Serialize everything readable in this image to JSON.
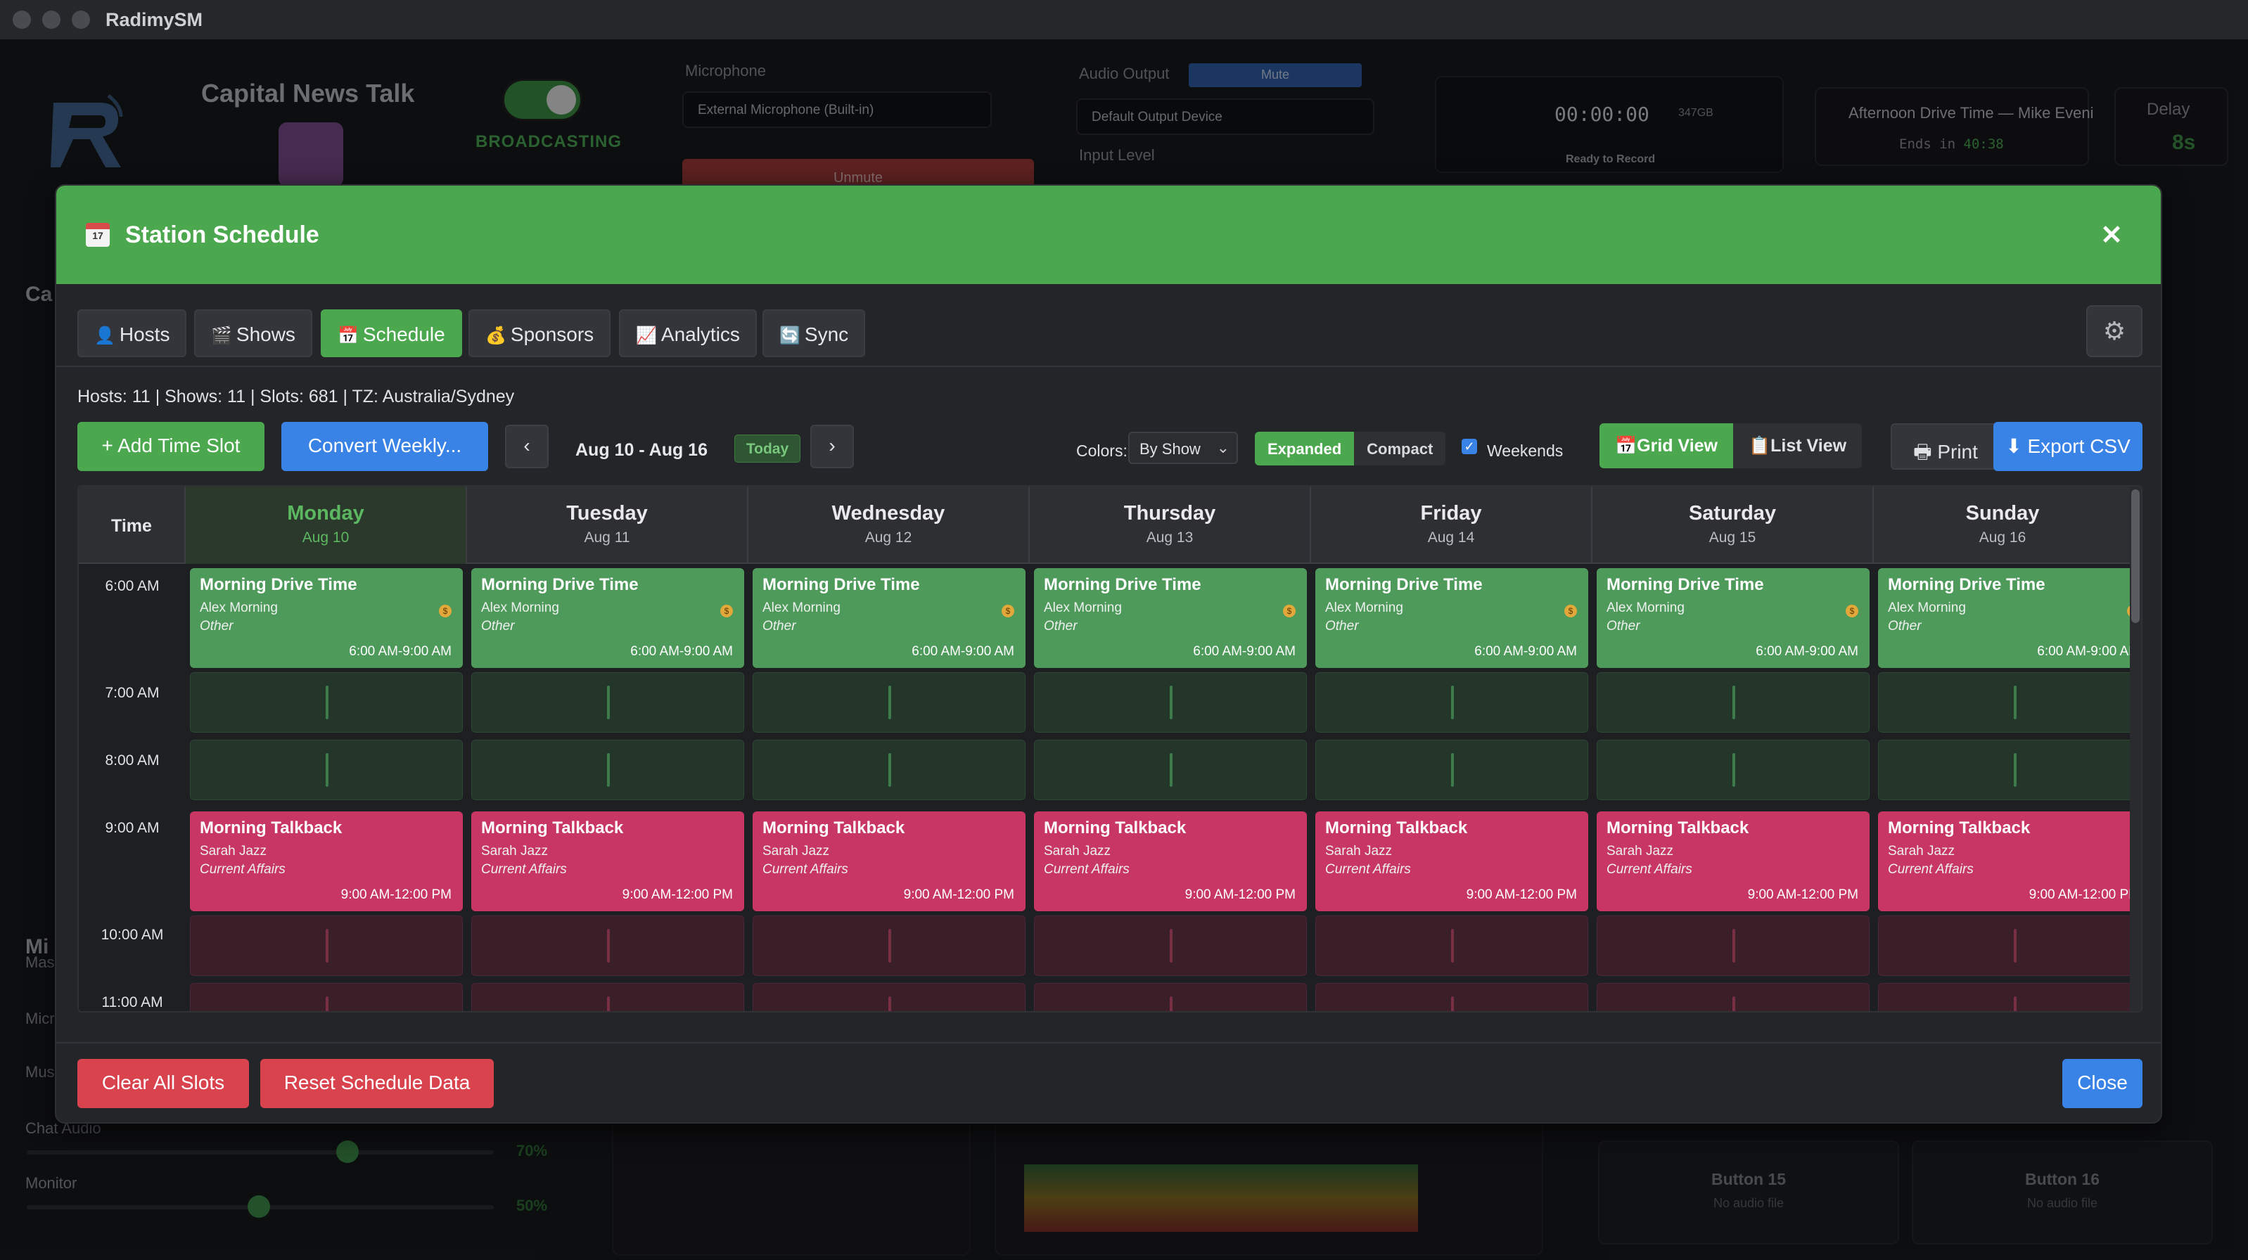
{
  "window": {
    "title": "RadimySM"
  },
  "background": {
    "station_name": "Capital News Talk",
    "broadcasting_label": "BROADCASTING",
    "microphone_label": "Microphone",
    "microphone_device": "External Microphone (Built-in)",
    "unmute_label": "Unmute",
    "audio_output_label": "Audio Output",
    "mute_label": "Mute",
    "output_device": "Default Output Device",
    "input_level_label": "Input Level",
    "timer": "00:00:00",
    "disk_free": "347GB",
    "ready_label": "Ready to Record",
    "now_playing": "Afternoon Drive Time — Mike Eveni",
    "ends_in_prefix": "Ends in",
    "ends_in_value": "40:38",
    "delay_label": "Delay",
    "delay_value": "8s",
    "left_heading": "Ca",
    "mixer_heading": "Mi",
    "faders": [
      {
        "label": "Mas",
        "percent": null
      },
      {
        "label": "Micr",
        "percent": null
      },
      {
        "label": "Mus",
        "percent": null
      },
      {
        "label": "Chat Audio",
        "percent": "70%",
        "level": 0.7
      },
      {
        "label": "Monitor",
        "percent": "50%",
        "level": 0.5
      }
    ],
    "buttons": [
      {
        "title": "Button 15",
        "subtitle": "No audio file"
      },
      {
        "title": "Button 16",
        "subtitle": "No audio file"
      }
    ]
  },
  "modal": {
    "title": "Station Schedule",
    "close_glyph": "✕",
    "tabs": [
      {
        "icon": "👤",
        "label": "Hosts"
      },
      {
        "icon": "🎬",
        "label": "Shows"
      },
      {
        "icon": "📅",
        "label": "Schedule",
        "active": true
      },
      {
        "icon": "💰",
        "label": "Sponsors"
      },
      {
        "icon": "📈",
        "label": "Analytics"
      },
      {
        "icon": "🔄",
        "label": "Sync"
      }
    ],
    "stats": "Hosts: 11 | Shows: 11 | Slots: 681 | TZ: Australia/Sydney",
    "toolbar": {
      "add_slot": "+ Add Time Slot",
      "convert_weekly": "Convert Weekly...",
      "prev": "‹",
      "next": "›",
      "week_range": "Aug 10 - Aug 16",
      "today": "Today",
      "colors_label": "Colors:",
      "colors_value": "By Show",
      "expanded": "Expanded",
      "compact": "Compact",
      "weekends": "Weekends",
      "grid_view": "Grid View",
      "list_view": "List View",
      "print": "Print",
      "export_csv": "Export CSV"
    },
    "grid": {
      "time_header": "Time",
      "days": [
        {
          "name": "Monday",
          "date": "Aug 10"
        },
        {
          "name": "Tuesday",
          "date": "Aug 11"
        },
        {
          "name": "Wednesday",
          "date": "Aug 12"
        },
        {
          "name": "Thursday",
          "date": "Aug 13"
        },
        {
          "name": "Friday",
          "date": "Aug 14"
        },
        {
          "name": "Saturday",
          "date": "Aug 15"
        },
        {
          "name": "Sunday",
          "date": "Aug 16"
        }
      ],
      "times": [
        "6:00 AM",
        "7:00 AM",
        "8:00 AM",
        "9:00 AM",
        "10:00 AM",
        "11:00 AM"
      ],
      "shows": {
        "morning_drive": {
          "title": "Morning Drive Time",
          "host": "Alex Morning",
          "genre": "Other",
          "time": "6:00 AM-9:00 AM",
          "color": "#4e9a5b"
        },
        "morning_talkback": {
          "title": "Morning Talkback",
          "host": "Sarah Jazz",
          "genre": "Current Affairs",
          "time": "9:00 AM-12:00 PM",
          "color": "#c83764"
        }
      }
    },
    "footer": {
      "clear_all": "Clear All Slots",
      "reset": "Reset Schedule Data",
      "close": "Close"
    }
  }
}
